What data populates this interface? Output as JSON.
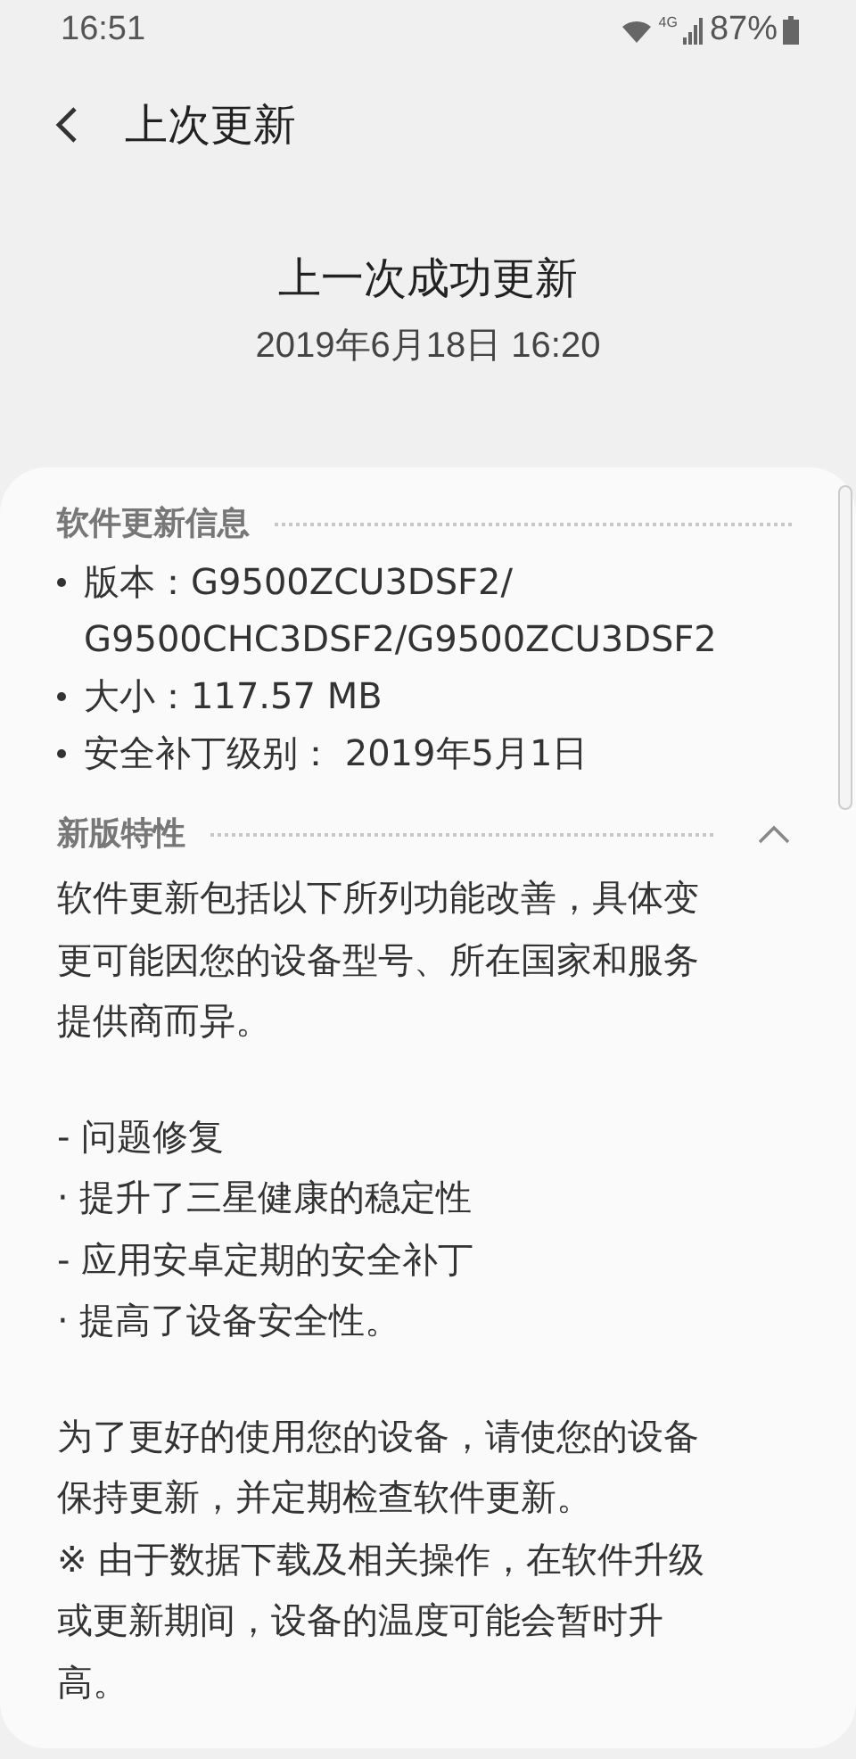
{
  "status_bar": {
    "time": "16:51",
    "network": "4G",
    "battery": "87%"
  },
  "header": {
    "title": "上次更新"
  },
  "summary": {
    "title": "上一次成功更新",
    "date": "2019年6月18日 16:20"
  },
  "info_section": {
    "title": "软件更新信息",
    "items": [
      {
        "lines": [
          "版本：G9500ZCU3DSF2/",
          "G9500CHC3DSF2/G9500ZCU3DSF2"
        ]
      },
      {
        "lines": [
          "大小：117.57 MB"
        ]
      },
      {
        "lines": [
          "安全补丁级别： 2019年5月1日"
        ]
      }
    ]
  },
  "features_section": {
    "title": "新版特性",
    "expanded": true,
    "groups": [
      [
        {
          "lines": [
            "软件更新包括以下所列功能改善，具体变",
            "更可能因您的设备型号、所在国家和服务",
            "提供商而异。"
          ]
        }
      ],
      [
        {
          "lines": [
            "- 问题修复"
          ]
        },
        {
          "lines": [
            "· 提升了三星健康的稳定性"
          ]
        },
        {
          "lines": [
            "- 应用安卓定期的安全补丁"
          ]
        },
        {
          "lines": [
            "· 提高了设备安全性。"
          ]
        }
      ],
      [
        {
          "lines": [
            "为了更好的使用您的设备，请使您的设备",
            "保持更新，并定期检查软件更新。"
          ]
        },
        {
          "lines": [
            "※ 由于数据下载及相关操作，在软件升级",
            "或更新期间，设备的温度可能会暂时升",
            "高。"
          ]
        }
      ]
    ]
  }
}
